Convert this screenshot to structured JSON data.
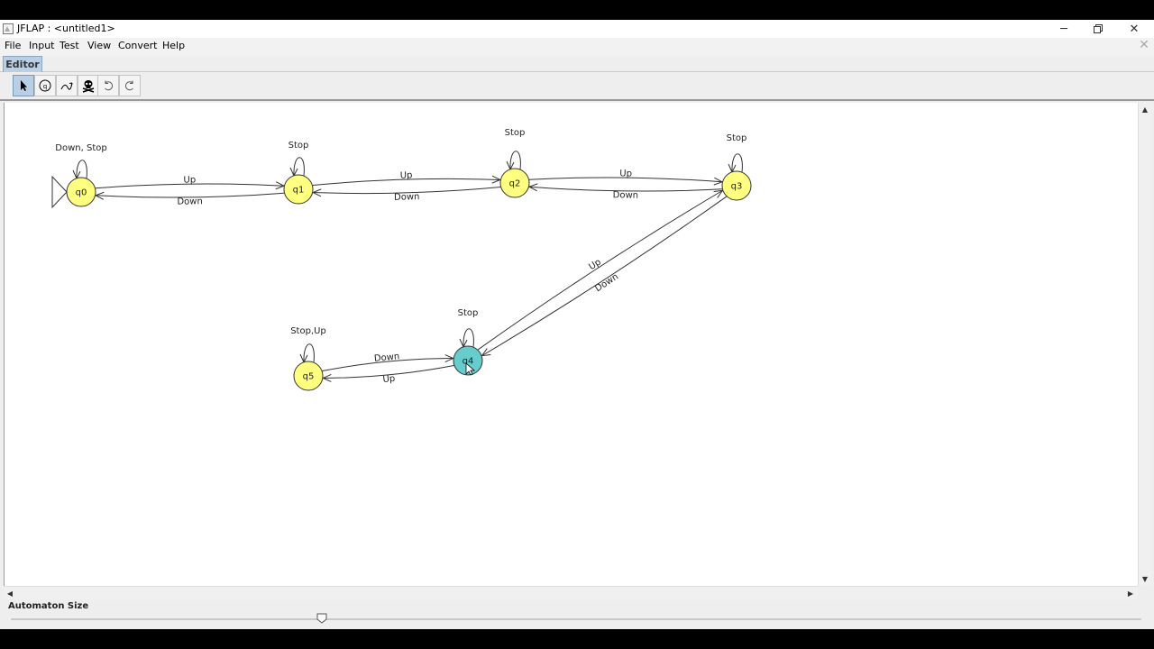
{
  "window": {
    "title": "JFLAP : <untitled1>"
  },
  "menu": [
    "File",
    "Input",
    "Test",
    "View",
    "Convert",
    "Help"
  ],
  "tabs": [
    {
      "label": "Editor",
      "active": true
    }
  ],
  "toolbar": {
    "tools": [
      {
        "name": "attribute-editor-tool",
        "icon": "pointer-arrow-icon",
        "selected": true
      },
      {
        "name": "state-creator-tool",
        "icon": "state-circle-icon",
        "selected": false
      },
      {
        "name": "transition-creator-tool",
        "icon": "transition-arrow-icon",
        "selected": false
      },
      {
        "name": "deleter-tool",
        "icon": "skull-icon",
        "selected": false
      },
      {
        "name": "undo-button",
        "icon": "undo-icon",
        "selected": false
      },
      {
        "name": "redo-button",
        "icon": "redo-icon",
        "selected": false
      }
    ]
  },
  "automaton": {
    "initial_state": "q0",
    "highlighted_state": "q4",
    "colors": {
      "state": "#ffff80",
      "selected_state": "#66cccc"
    },
    "states": [
      "q0",
      "q1",
      "q2",
      "q3",
      "q4",
      "q5"
    ],
    "transitions": [
      {
        "from": "q0",
        "to": "q0",
        "label": "Down, Stop"
      },
      {
        "from": "q0",
        "to": "q1",
        "label": "Up"
      },
      {
        "from": "q1",
        "to": "q0",
        "label": "Down"
      },
      {
        "from": "q1",
        "to": "q1",
        "label": "Stop"
      },
      {
        "from": "q1",
        "to": "q2",
        "label": "Up"
      },
      {
        "from": "q2",
        "to": "q1",
        "label": "Down"
      },
      {
        "from": "q2",
        "to": "q2",
        "label": "Stop"
      },
      {
        "from": "q2",
        "to": "q3",
        "label": "Up"
      },
      {
        "from": "q3",
        "to": "q2",
        "label": "Down"
      },
      {
        "from": "q3",
        "to": "q3",
        "label": "Stop"
      },
      {
        "from": "q3",
        "to": "q4",
        "label": "Down"
      },
      {
        "from": "q4",
        "to": "q3",
        "label": "Up"
      },
      {
        "from": "q4",
        "to": "q4",
        "label": "Stop"
      },
      {
        "from": "q5",
        "to": "q4",
        "label": "Down"
      },
      {
        "from": "q4",
        "to": "q5",
        "label": "Up"
      },
      {
        "from": "q5",
        "to": "q5",
        "label": "Stop,Up"
      }
    ]
  },
  "footer": {
    "size_label": "Automaton Size",
    "size_level": 0.275
  }
}
